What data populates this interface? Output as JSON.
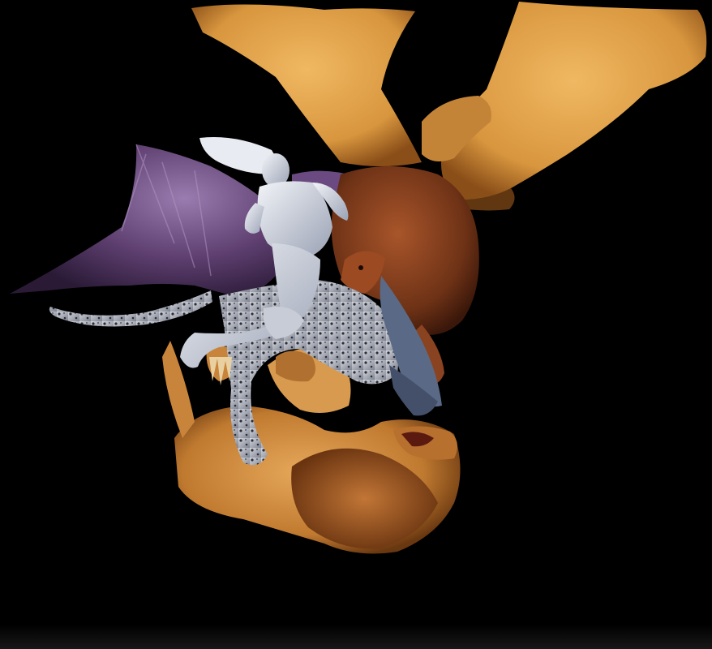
{
  "scene": {
    "background_color": "#000000",
    "subjects": [
      "winged-lion",
      "woman-rider",
      "spotted-bat-winged-creature",
      "golden-lion"
    ],
    "palette": {
      "golden_wing": "#e2a24e",
      "golden_wing_shadow": "#9a5a1e",
      "purple_wing": "#4b2f5c",
      "purple_wing_light": "#8a6a9e",
      "brown_lion": "#7a3a1c",
      "golden_lion": "#d08a3a",
      "golden_lion_shadow": "#7a4212",
      "rider_skin": "#d9dde6",
      "rider_shadow": "#8e96a8",
      "spotted_fur": "#b9bcc4",
      "spots": "#2b2e36",
      "dragon_head": "#5a6a86"
    }
  }
}
